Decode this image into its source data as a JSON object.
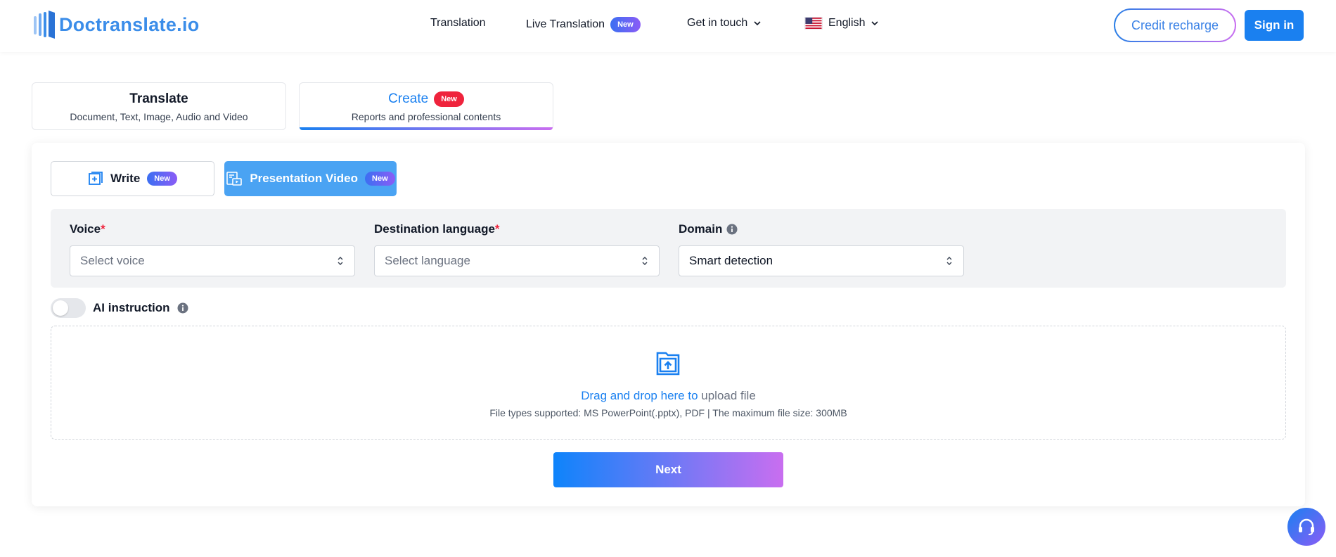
{
  "brand": {
    "name": "Doctranslate.io",
    "color": "#3b8de9"
  },
  "nav": {
    "translation": "Translation",
    "live_translation": "Live Translation",
    "live_badge": "New",
    "get_in_touch": "Get in touch",
    "language": "English"
  },
  "header_actions": {
    "credit_recharge": "Credit recharge",
    "sign_in": "Sign in"
  },
  "mode_tabs": [
    {
      "title": "Translate",
      "subtitle": "Document, Text, Image, Audio and Video"
    },
    {
      "title": "Create",
      "badge": "New",
      "subtitle": "Reports and professional contents"
    }
  ],
  "sub_tabs": {
    "write": {
      "label": "Write",
      "badge": "New"
    },
    "video": {
      "label": "Presentation Video",
      "badge": "New"
    }
  },
  "fields": {
    "voice": {
      "label": "Voice",
      "required": "*",
      "placeholder": "Select voice"
    },
    "destination": {
      "label": "Destination language",
      "required": "*",
      "placeholder": "Select language"
    },
    "domain": {
      "label": "Domain",
      "value": "Smart detection"
    }
  },
  "ai_instruction": {
    "label": "AI instruction"
  },
  "upload": {
    "highlight": "Drag and drop here to",
    "rest": " upload file",
    "supported": "File types supported: MS PowerPoint(.pptx), PDF | The maximum file size: 300MB"
  },
  "next_button": "Next",
  "colors": {
    "primary": "#1a80f0",
    "accent": "#c96ef0",
    "new_badge_red": "#ef233c"
  }
}
